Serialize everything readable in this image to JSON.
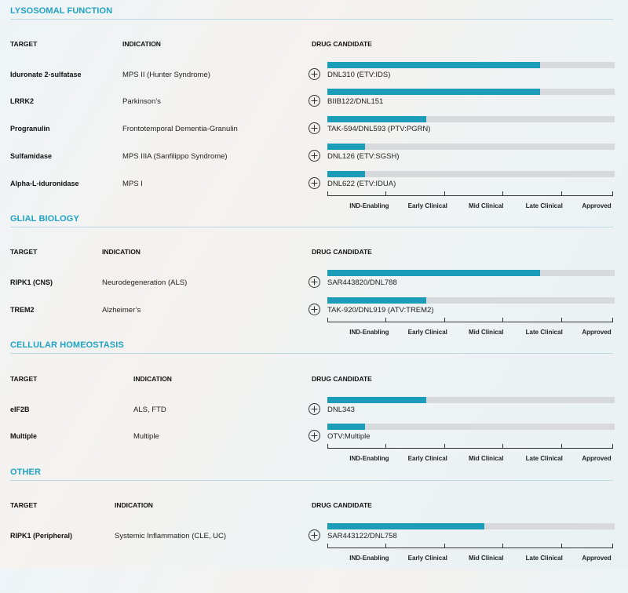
{
  "colors": {
    "accent": "#1fa3c4",
    "bar_fill": "#1b9cb9",
    "bar_track": "#d7d9dd"
  },
  "stages": [
    "IND-Enabling",
    "Early Clinical",
    "Mid Clinical",
    "Late Clinical",
    "Approved"
  ],
  "sections": [
    {
      "title": "LYSOSOMAL FUNCTION",
      "headers": {
        "target": "TARGET",
        "indication": "INDICATION",
        "drug": "DRUG CANDIDATE"
      },
      "rows": [
        {
          "target": "Iduronate 2-sulfatase",
          "indication": "MPS II (Hunter Syndrome)",
          "drug": "DNL310 (ETV:IDS)",
          "progress": 0.74
        },
        {
          "target": "LRRK2",
          "indication": "Parkinson’s",
          "drug": "BIIB122/DNL151",
          "progress": 0.74
        },
        {
          "target": "Progranulin",
          "indication": "Frontotemporal Dementia-Granulin",
          "drug": "TAK-594/DNL593 (PTV:PGRN)",
          "progress": 0.345
        },
        {
          "target": "Sulfamidase",
          "indication": "MPS IIIA (Sanfilippo Syndrome)",
          "drug": "DNL126 (ETV:SGSH)",
          "progress": 0.13
        },
        {
          "target": "Alpha-L-iduronidase",
          "indication": "MPS I",
          "drug": "DNL622 (ETV:IDUA)",
          "progress": 0.13
        }
      ]
    },
    {
      "title": "GLIAL BIOLOGY",
      "headers": {
        "target": "TARGET",
        "indication": "INDICATION",
        "drug": "DRUG CANDIDATE"
      },
      "rows": [
        {
          "target": "RIPK1 (CNS)",
          "indication": "Neurodegeneration (ALS)",
          "drug": "SAR443820/DNL788",
          "progress": 0.74
        },
        {
          "target": "TREM2",
          "indication": "Alzheimer’s",
          "drug": "TAK-920/DNL919 (ATV:TREM2)",
          "progress": 0.345
        }
      ]
    },
    {
      "title": "CELLULAR HOMEOSTASIS",
      "headers": {
        "target": "TARGET",
        "indication": "INDICATION",
        "drug": "DRUG CANDIDATE"
      },
      "rows": [
        {
          "target": "eIF2B",
          "indication": "ALS, FTD",
          "drug": "DNL343",
          "progress": 0.345
        },
        {
          "target": "Multiple",
          "indication": "Multiple",
          "drug": "OTV:Multiple",
          "progress": 0.13
        }
      ]
    },
    {
      "title": "OTHER",
      "headers": {
        "target": "TARGET",
        "indication": "INDICATION",
        "drug": "DRUG CANDIDATE"
      },
      "rows": [
        {
          "target": "RIPK1 (Peripheral)",
          "indication": "Systemic Inflammation (CLE, UC)",
          "drug": "SAR443122/DNL758",
          "progress": 0.547
        }
      ]
    }
  ]
}
